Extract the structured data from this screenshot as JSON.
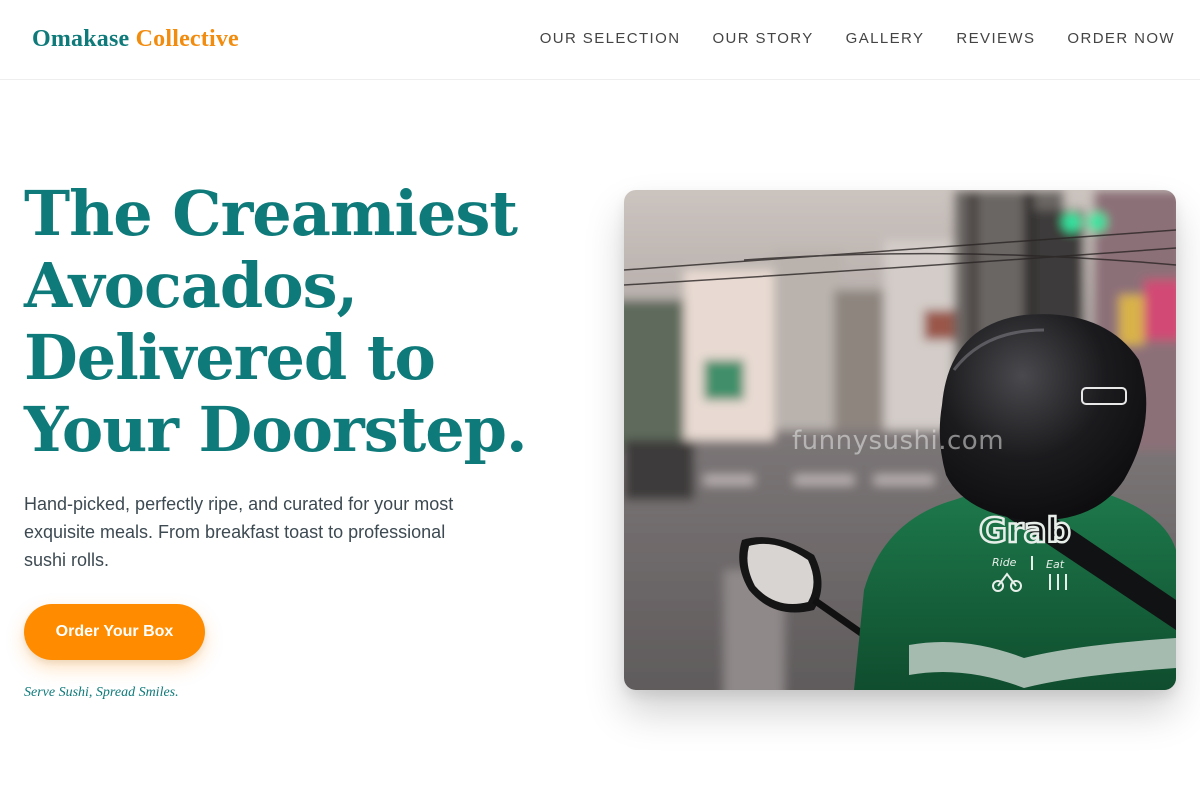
{
  "brand": {
    "name_part1": "Omakase",
    "name_part2": "Collective"
  },
  "nav": [
    {
      "label": "OUR SELECTION"
    },
    {
      "label": "OUR STORY"
    },
    {
      "label": "GALLERY"
    },
    {
      "label": "REVIEWS"
    },
    {
      "label": "ORDER NOW"
    }
  ],
  "hero": {
    "headline_lines": [
      "The Creamiest",
      "Avocados,",
      "Delivered to",
      "Your Doorstep."
    ],
    "description": "Hand-picked, perfectly ripe, and curated for your most exquisite meals. From breakfast toast to professional sushi rolls.",
    "cta_label": "Order Your Box",
    "tagline": "Serve Sushi, Spread Smiles."
  },
  "photo": {
    "watermark": "funnysushi.com",
    "jacket_text": {
      "logo": "Grab",
      "ride": "Ride",
      "eat": "Eat"
    }
  },
  "colors": {
    "primary": "#0f7a7a",
    "accent": "#ff8c00",
    "text": "#3d4a52"
  }
}
